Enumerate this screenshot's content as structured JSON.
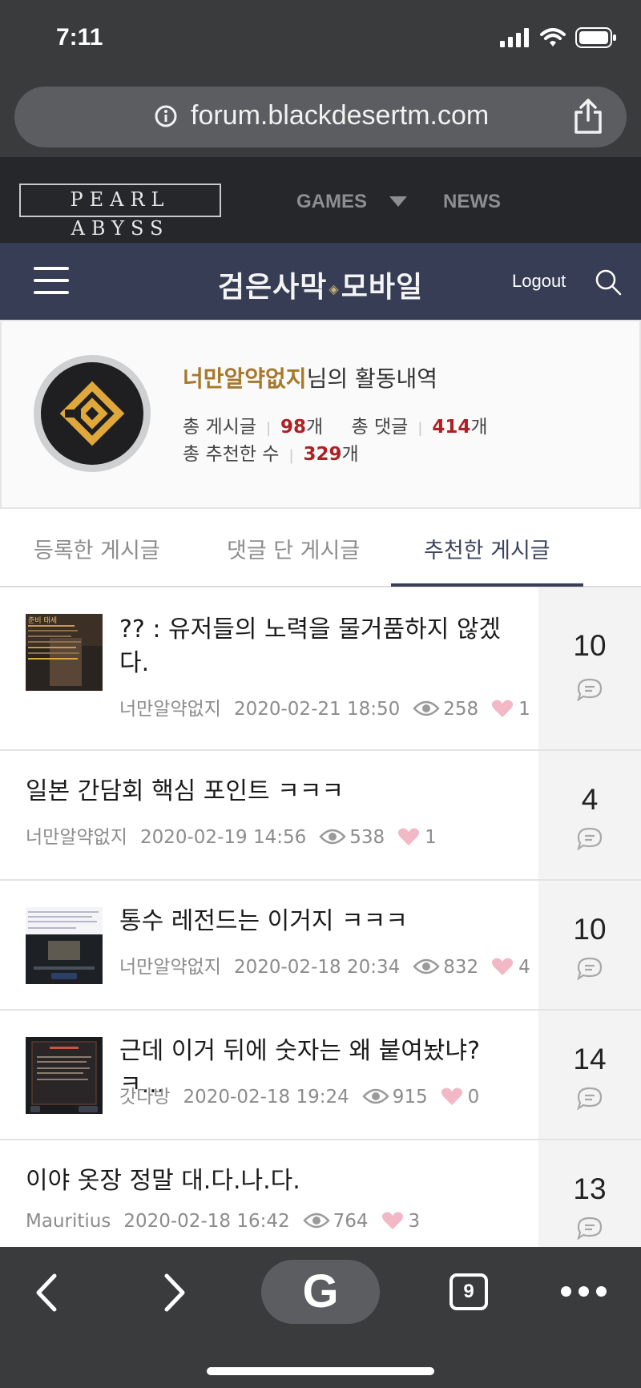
{
  "status": {
    "time": "7:11"
  },
  "browser": {
    "url": "forum.blackdesertm.com",
    "tab_count": "9",
    "google_label": "G"
  },
  "site_nav": {
    "logo": "PEARL ABYSS",
    "games": "GAMES",
    "news": "NEWS"
  },
  "game_header": {
    "title_left": "검은사막",
    "title_right": "모바일",
    "logout": "Logout"
  },
  "profile": {
    "nickname": "너만알약없지",
    "suffix": "님의 활동내역",
    "posts_label": "총 게시글",
    "posts_value": "98",
    "posts_unit": "개",
    "comments_label": "총 댓글",
    "comments_value": "414",
    "comments_unit": "개",
    "likes_label": "총 추천한 수",
    "likes_value": "329",
    "likes_unit": "개"
  },
  "tabs": [
    {
      "label": "등록한 게시글"
    },
    {
      "label": "댓글 단 게시글"
    },
    {
      "label": "추천한 게시글"
    }
  ],
  "posts": [
    {
      "title_line1": "?? : 유저들의 노력을 물거품하지 않겠",
      "title_line2": "다.",
      "author": "너만알약없지",
      "date": "2020-02-21 18:50",
      "views": "258",
      "likes": "1",
      "comments": "10",
      "thumb_caption": "준비 태세"
    },
    {
      "title_line1": "일본 간담회 핵심 포인트 ㅋㅋㅋ",
      "author": "너만알약없지",
      "date": "2020-02-19 14:56",
      "views": "538",
      "likes": "1",
      "comments": "4"
    },
    {
      "title_line1": "통수 레전드는 이거지 ㅋㅋㅋ",
      "author": "너만알약없지",
      "date": "2020-02-18 20:34",
      "views": "832",
      "likes": "4",
      "comments": "10"
    },
    {
      "title_line1": "근데 이거 뒤에 숫자는 왜 붙여놨냐?ㅋ...",
      "author": "갓다방",
      "date": "2020-02-18 19:24",
      "views": "915",
      "likes": "0",
      "comments": "14"
    },
    {
      "title_line1": "이야 옷장 정말 대.다.나.다.",
      "author": "Mauritius",
      "date": "2020-02-18 16:42",
      "views": "764",
      "likes": "3",
      "comments": "13"
    }
  ],
  "colors": {
    "accent_nick": "#a8782a",
    "accent_num": "#b01f24",
    "header_bg": "#363d54",
    "heart": "#f2b8c6"
  }
}
